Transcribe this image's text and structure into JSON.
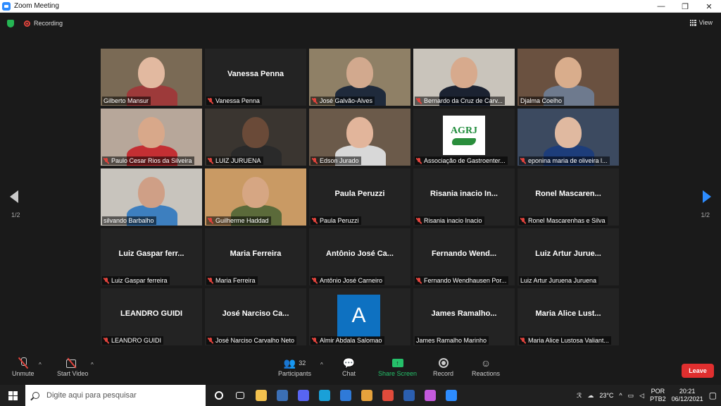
{
  "window": {
    "title": "Zoom Meeting",
    "controls": [
      "—",
      "❐",
      "✕"
    ]
  },
  "top": {
    "recording_label": "Recording",
    "view_label": "View"
  },
  "pagination": {
    "left": "1/2",
    "right": "1/2"
  },
  "participants": [
    {
      "name": "Gilberto Mansur",
      "video": true,
      "muted": false,
      "bg": "#7a6a55",
      "skin": "#e2b9a0",
      "shirt": "#9d3a3a"
    },
    {
      "name": "Vanessa Penna",
      "video": false,
      "muted": true,
      "big": "Vanessa Penna"
    },
    {
      "name": "José Galvão-Alves",
      "video": true,
      "muted": true,
      "bg": "#8f8066",
      "skin": "#d2a98e",
      "shirt": "#1f2a3b"
    },
    {
      "name": "Bernardo da Cruz de Carv...",
      "video": true,
      "muted": true,
      "bg": "#c9c4bb",
      "skin": "#d7aa8d",
      "shirt": "#1b2231"
    },
    {
      "name": "Djalma Coelho",
      "video": true,
      "muted": false,
      "active": true,
      "bg": "#6a5140",
      "skin": "#d9ad8c",
      "shirt": "#6e7a8e"
    },
    {
      "name": "Paulo Cesar Rios da Silveira",
      "video": true,
      "muted": true,
      "bg": "#b7a79a",
      "skin": "#d8a88a",
      "shirt": "#c32f33"
    },
    {
      "name": "LUIZ JURUENA",
      "video": true,
      "muted": true,
      "bg": "#3a3530",
      "skin": "#6a4a38",
      "shirt": "#2a2a2a"
    },
    {
      "name": "Edson Jurado",
      "video": true,
      "muted": true,
      "bg": "#6b5a4a",
      "skin": "#e2b59b",
      "shirt": "#d8d8d8"
    },
    {
      "name": "Associação de Gastroenter...",
      "video": false,
      "muted": true,
      "logo": {
        "text": "AGRJ"
      }
    },
    {
      "name": "eponina maria de oliveira l...",
      "video": true,
      "muted": true,
      "bg": "#3c4a60",
      "skin": "#e0b9a0",
      "shirt": "#1d3d7a"
    },
    {
      "name": "silvando Barbalho",
      "video": true,
      "muted": false,
      "bg": "#c8c4bd",
      "skin": "#cf9f86",
      "shirt": "#3d7fbf"
    },
    {
      "name": "Guilherme Haddad",
      "video": true,
      "muted": true,
      "bg": "#c99a64",
      "skin": "#d6a683",
      "shirt": "#5b6a3a"
    },
    {
      "name": "Paula Peruzzi",
      "video": false,
      "muted": true,
      "big": "Paula Peruzzi"
    },
    {
      "name": "Risania inacio Inacio",
      "video": false,
      "muted": true,
      "big": "Risania inacio In..."
    },
    {
      "name": "Ronel Mascarenhas e Silva",
      "video": false,
      "muted": true,
      "big": "Ronel Mascaren..."
    },
    {
      "name": "Luiz Gaspar ferreira",
      "video": false,
      "muted": true,
      "big": "Luiz Gaspar ferr..."
    },
    {
      "name": "Maria Ferreira",
      "video": false,
      "muted": true,
      "big": "Maria Ferreira"
    },
    {
      "name": "Antônio José Carneiro",
      "video": false,
      "muted": true,
      "big": "Antônio José Ca..."
    },
    {
      "name": "Fernando Wendhausen Por...",
      "video": false,
      "muted": true,
      "big": "Fernando Wend..."
    },
    {
      "name": "Luiz Artur Juruena Juruena",
      "video": false,
      "muted": false,
      "big": "Luiz Artur Jurue..."
    },
    {
      "name": "LEANDRO GUIDI",
      "video": false,
      "muted": true,
      "big": "LEANDRO GUIDI"
    },
    {
      "name": "José Narciso Carvalho Neto",
      "video": false,
      "muted": true,
      "big": "José Narciso Ca..."
    },
    {
      "name": "Almir Abdala Salomao",
      "video": false,
      "muted": true,
      "avatar": "A"
    },
    {
      "name": "James Ramalho Marinho",
      "video": false,
      "muted": false,
      "big": "James Ramalho..."
    },
    {
      "name": "Maria Alice Lustosa Valiant...",
      "video": false,
      "muted": true,
      "big": "Maria Alice Lust..."
    }
  ],
  "toolbar": {
    "unmute": "Unmute",
    "start_video": "Start Video",
    "participants": "Participants",
    "participants_count": "32",
    "chat": "Chat",
    "share_screen": "Share Screen",
    "record": "Record",
    "reactions": "Reactions",
    "leave": "Leave"
  },
  "taskbar": {
    "search_placeholder": "Digite aqui para pesquisar",
    "apps": [
      {
        "name": "cortana-icon",
        "color": "#202020"
      },
      {
        "name": "task-view-icon",
        "color": "#202020"
      },
      {
        "name": "file-explorer-icon",
        "color": "#f2c14e"
      },
      {
        "name": "app-icon",
        "color": "#3b6fb5"
      },
      {
        "name": "discord-icon",
        "color": "#5865f2"
      },
      {
        "name": "edge-icon",
        "color": "#1aa0d8"
      },
      {
        "name": "store-icon",
        "color": "#2f7ad8"
      },
      {
        "name": "folder-app-icon",
        "color": "#e6a23c"
      },
      {
        "name": "chrome-icon",
        "color": "#e04b3b"
      },
      {
        "name": "word-icon",
        "color": "#2b5fb0"
      },
      {
        "name": "paint-icon",
        "color": "#c45adc"
      },
      {
        "name": "zoom-icon",
        "color": "#2d8cff"
      }
    ],
    "temperature": "23°C",
    "lang1": "POR",
    "lang2": "PTB2",
    "time": "20:21",
    "date": "06/12/2021"
  }
}
